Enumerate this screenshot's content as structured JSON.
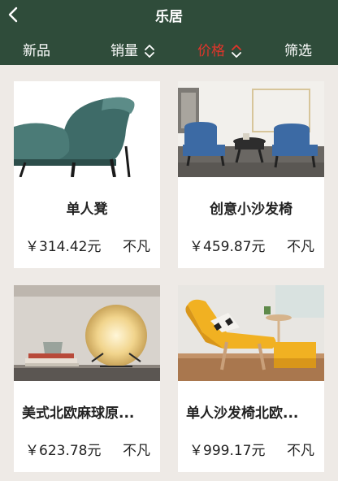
{
  "header": {
    "title": "乐居",
    "background": "#2f4c3a"
  },
  "tabs": [
    {
      "label": "新品",
      "active": false,
      "sortable": false
    },
    {
      "label": "销量",
      "active": false,
      "sortable": true
    },
    {
      "label": "价格",
      "active": true,
      "sortable": true
    },
    {
      "label": "筛选",
      "active": false,
      "sortable": false
    }
  ],
  "colors": {
    "active_tab": "#e0352b",
    "page_background": "#eeeae6"
  },
  "products": [
    {
      "name": "单人凳",
      "price": "￥314.42元",
      "brand": "不凡",
      "image": "teal-armchair-closeup"
    },
    {
      "name": "创意小沙发椅",
      "price": "￥459.87元",
      "brand": "不凡",
      "image": "two-blue-armchairs"
    },
    {
      "name": "美式北欧麻球原...",
      "price": "￥623.78元",
      "brand": "不凡",
      "image": "glowing-ball-lamp"
    },
    {
      "name": "单人沙发椅北欧...",
      "price": "￥999.17元",
      "brand": "不凡",
      "image": "yellow-lounge-chair"
    }
  ]
}
